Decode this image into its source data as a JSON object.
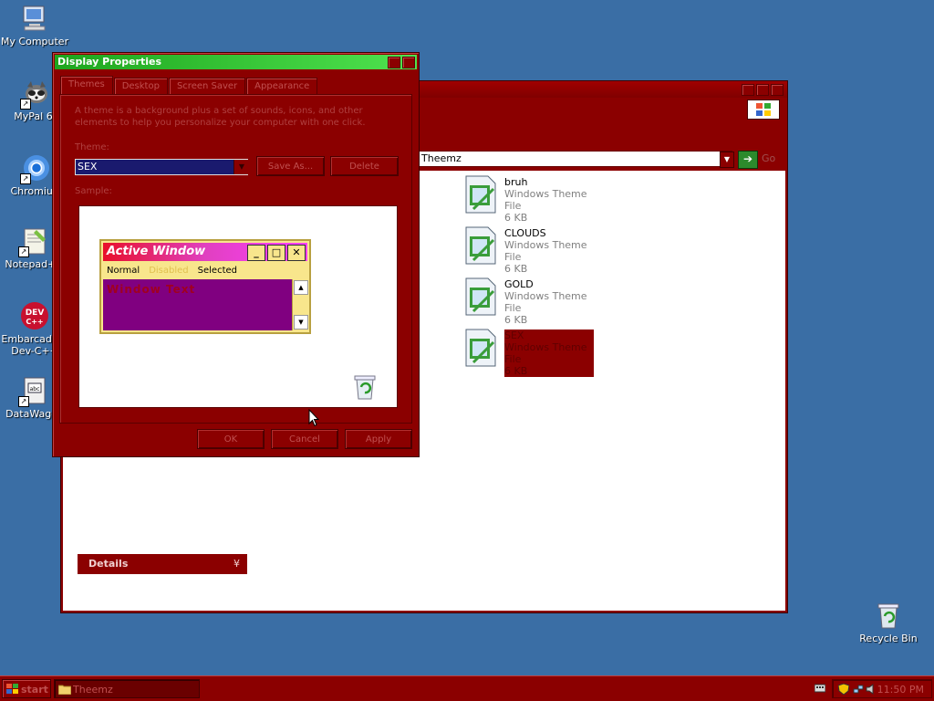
{
  "desktop": {
    "icons": [
      {
        "label": "My Computer"
      },
      {
        "label": "MyPal 68"
      },
      {
        "label": "Chromium"
      },
      {
        "label": "Notepad++"
      },
      {
        "label": "Embarcadero Dev-C++"
      },
      {
        "label": "DataWagon"
      }
    ],
    "recycle_bin": "Recycle Bin"
  },
  "explorer": {
    "address": "Theemz",
    "go_label": "Go",
    "details_label": "Details",
    "files": [
      {
        "name": "bruh",
        "type": "Windows Theme File",
        "size": "6 KB",
        "selected": false
      },
      {
        "name": "CLOUDS",
        "type": "Windows Theme File",
        "size": "6 KB",
        "selected": false
      },
      {
        "name": "GOLD",
        "type": "Windows Theme File",
        "size": "6 KB",
        "selected": false
      },
      {
        "name": "SEX",
        "type": "Windows Theme File",
        "size": "6 KB",
        "selected": true
      }
    ]
  },
  "dialog": {
    "title": "Display Properties",
    "tabs": [
      "Themes",
      "Desktop",
      "Screen Saver",
      "Appearance"
    ],
    "description": "A theme is a background plus a set of sounds, icons, and other elements to help you personalize your computer with one click.",
    "theme_label": "Theme:",
    "theme_value": "SEX",
    "save_as": "Save As...",
    "delete": "Delete",
    "sample_label": "Sample:",
    "preview": {
      "title": "Active Window",
      "menu": [
        "Normal",
        "Disabled",
        "Selected"
      ],
      "window_text": "Window Text"
    },
    "ok": "OK",
    "cancel": "Cancel",
    "apply": "Apply"
  },
  "taskbar": {
    "start": "start",
    "task": "Theemz",
    "clock": "11:50 PM"
  }
}
